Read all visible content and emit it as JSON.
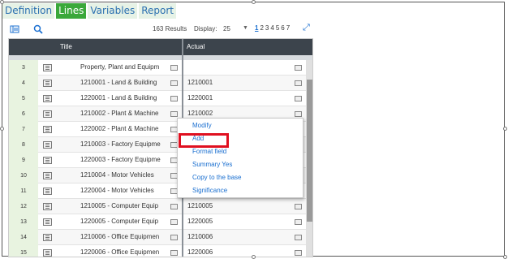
{
  "tabs": [
    "Definition",
    "Lines",
    "Variables",
    "Report"
  ],
  "active_tab": "Lines",
  "toolbar": {
    "results": "163 Results",
    "display_label": "Display:",
    "display_value": "25",
    "pages": [
      "1",
      "2",
      "3",
      "4",
      "5",
      "6",
      "7"
    ],
    "current_page": "1"
  },
  "columns": {
    "title": "Title",
    "actual": "Actual"
  },
  "rows": [
    {
      "n": "3",
      "title": "Property, Plant and Equipm",
      "actual": ""
    },
    {
      "n": "4",
      "title": "1210001 - Land & Building",
      "actual": "1210001"
    },
    {
      "n": "5",
      "title": "1220001 - Land & Building",
      "actual": "1220001"
    },
    {
      "n": "6",
      "title": "1210002 - Plant & Machine",
      "actual": "1210002"
    },
    {
      "n": "7",
      "title": "1220002 - Plant & Machine",
      "actual": ""
    },
    {
      "n": "8",
      "title": "1210003 - Factory Equipme",
      "actual": ""
    },
    {
      "n": "9",
      "title": "1220003 - Factory Equipme",
      "actual": ""
    },
    {
      "n": "10",
      "title": "1210004 - Motor Vehicles",
      "actual": ""
    },
    {
      "n": "11",
      "title": "1220004 - Motor Vehicles",
      "actual": ""
    },
    {
      "n": "12",
      "title": "1210005 - Computer Equip",
      "actual": "1210005"
    },
    {
      "n": "13",
      "title": "1220005 - Computer Equip",
      "actual": "1220005"
    },
    {
      "n": "14",
      "title": "1210006 - Office Equipmen",
      "actual": "1210006"
    },
    {
      "n": "15",
      "title": "1220006 - Office Equipmen",
      "actual": "1220006"
    }
  ],
  "context_menu": [
    "Modify",
    "Add",
    "Format field",
    "Summary Yes",
    "Copy to the base",
    "Significance"
  ],
  "highlighted_item": "Add",
  "colors": {
    "active_tab": "#3aa83a",
    "header": "#3c444c",
    "link": "#1a6fd0",
    "highlight": "#e01020"
  }
}
